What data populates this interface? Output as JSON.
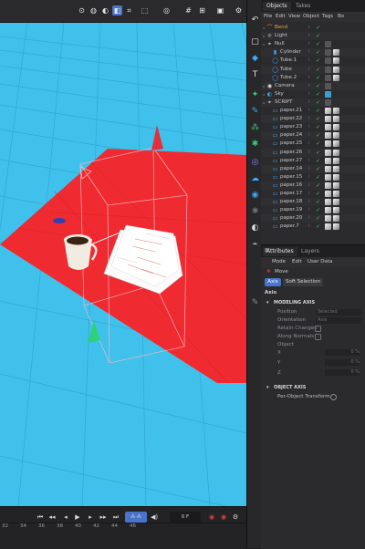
{
  "viewport": {
    "toolbar_icons": [
      "cursor-icon",
      "light-bulb-icon",
      "view-icon",
      "cube-view-icon",
      "grid-icon",
      "wireframe-icon",
      "globe-icon",
      "grid-snap-icon",
      "frame-icon",
      "render-icon"
    ]
  },
  "timeline": {
    "frame_value": "0 F",
    "ruler": [
      "32",
      "34",
      "36",
      "38",
      "40",
      "42",
      "44",
      "46"
    ],
    "accent": "#4a74c9"
  },
  "objects_panel": {
    "tabs": [
      "Objects",
      "Takes"
    ],
    "menu": [
      "File",
      "Edit",
      "View",
      "Object",
      "Tags",
      "Bo"
    ],
    "rows": [
      {
        "name": "Bend",
        "color": "#f0a23a",
        "icon": "bend-icon",
        "indent": 0
      },
      {
        "name": "Light",
        "color": "#c9c9cc",
        "icon": "light-icon",
        "indent": 0
      },
      {
        "name": "Null",
        "color": "#c9c9cc",
        "icon": "null-icon",
        "indent": 0
      },
      {
        "name": "Cylinder",
        "color": "#c9c9cc",
        "icon": "cylinder-icon",
        "indent": 1
      },
      {
        "name": "Tube.1",
        "color": "#c9c9cc",
        "icon": "tube-icon",
        "indent": 1
      },
      {
        "name": "Tube",
        "color": "#c9c9cc",
        "icon": "tube-icon",
        "indent": 1
      },
      {
        "name": "Tube.2",
        "color": "#c9c9cc",
        "icon": "tube-icon",
        "indent": 1
      },
      {
        "name": "Camera",
        "color": "#c9c9cc",
        "icon": "camera-icon",
        "indent": 0
      },
      {
        "name": "Sky",
        "color": "#c9c9cc",
        "icon": "sky-icon",
        "indent": 0
      },
      {
        "name": "SCRIPT",
        "color": "#c9c9cc",
        "icon": "null-icon",
        "indent": 0
      },
      {
        "name": "paper.21",
        "color": "#c9c9cc",
        "icon": "paper-icon",
        "indent": 1
      },
      {
        "name": "paper.22",
        "color": "#c9c9cc",
        "icon": "paper-icon",
        "indent": 1
      },
      {
        "name": "paper.23",
        "color": "#c9c9cc",
        "icon": "paper-icon",
        "indent": 1
      },
      {
        "name": "paper.24",
        "color": "#c9c9cc",
        "icon": "paper-icon",
        "indent": 1
      },
      {
        "name": "paper.25",
        "color": "#c9c9cc",
        "icon": "paper-icon",
        "indent": 1
      },
      {
        "name": "paper.26",
        "color": "#c9c9cc",
        "icon": "paper-icon",
        "indent": 1
      },
      {
        "name": "paper.27",
        "color": "#c9c9cc",
        "icon": "paper-icon",
        "indent": 1
      },
      {
        "name": "paper.14",
        "color": "#c9c9cc",
        "icon": "paper-icon",
        "indent": 1
      },
      {
        "name": "paper.15",
        "color": "#c9c9cc",
        "icon": "paper-icon",
        "indent": 1
      },
      {
        "name": "paper.16",
        "color": "#c9c9cc",
        "icon": "paper-icon",
        "indent": 1
      },
      {
        "name": "paper.17",
        "color": "#c9c9cc",
        "icon": "paper-icon",
        "indent": 1
      },
      {
        "name": "paper.18",
        "color": "#c9c9cc",
        "icon": "paper-icon",
        "indent": 1
      },
      {
        "name": "paper.19",
        "color": "#c9c9cc",
        "icon": "paper-icon",
        "indent": 1
      },
      {
        "name": "paper.20",
        "color": "#c9c9cc",
        "icon": "paper-icon",
        "indent": 1
      },
      {
        "name": "paper.7",
        "color": "#c9c9cc",
        "icon": "paper-icon",
        "indent": 1
      }
    ]
  },
  "attributes_panel": {
    "tabs": [
      "Attributes",
      "Layers"
    ],
    "menu": [
      "Mode",
      "Edit",
      "User Data"
    ],
    "object_label": "Move",
    "subtabs": [
      "Axis",
      "Soft Selection"
    ],
    "section_title": "Axis",
    "modeling_axis": "MODELING AXIS",
    "fields": [
      {
        "label": "Position",
        "value": "Selected"
      },
      {
        "label": "Orientation",
        "value": "Axis"
      },
      {
        "label": "Retain Changes",
        "value": ""
      },
      {
        "label": "Along Normals",
        "value": ""
      },
      {
        "label": "Object",
        "value": ""
      }
    ],
    "xyz": [
      {
        "axis": "X",
        "value": "0 %"
      },
      {
        "axis": "Y",
        "value": "0 %"
      },
      {
        "axis": "Z",
        "value": "0 %"
      }
    ],
    "object_axis": "OBJECT AXIS",
    "per_object": "Per-Object Transform"
  },
  "colors": {
    "sky": "#3fc1ec",
    "ground": "#ef2b31",
    "active_blue": "#4a74c9",
    "check_green": "#3bd46b"
  }
}
